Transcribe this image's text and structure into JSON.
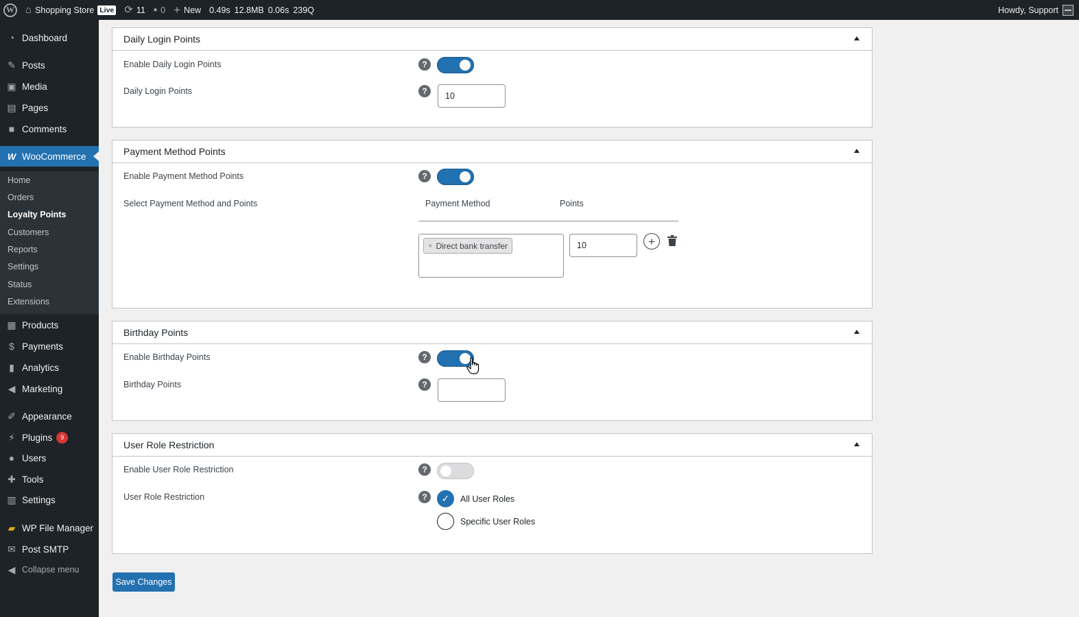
{
  "adminbar": {
    "site_name": "Shopping Store",
    "live_badge": "Live",
    "updates_count": "11",
    "comments_count": "0",
    "new_label": "New",
    "perf": [
      "0.49s",
      "12.8MB",
      "0.06s",
      "239Q"
    ],
    "greeting": "Howdy, Support"
  },
  "sidebar": {
    "items": [
      {
        "label": "Dashboard",
        "icon": "dashboard-icon"
      },
      {
        "label": "Posts",
        "icon": "pushpin-icon"
      },
      {
        "label": "Media",
        "icon": "media-icon"
      },
      {
        "label": "Pages",
        "icon": "pages-icon"
      },
      {
        "label": "Comments",
        "icon": "comment-icon"
      },
      {
        "label": "WooCommerce",
        "icon": "woocommerce-icon"
      },
      {
        "label": "Products",
        "icon": "products-icon"
      },
      {
        "label": "Payments",
        "icon": "payments-icon"
      },
      {
        "label": "Analytics",
        "icon": "analytics-icon"
      },
      {
        "label": "Marketing",
        "icon": "megaphone-icon"
      },
      {
        "label": "Appearance",
        "icon": "brush-icon"
      },
      {
        "label": "Plugins",
        "icon": "plugin-icon",
        "badge": "9"
      },
      {
        "label": "Users",
        "icon": "users-icon"
      },
      {
        "label": "Tools",
        "icon": "wrench-icon"
      },
      {
        "label": "Settings",
        "icon": "settings-icon"
      },
      {
        "label": "WP File Manager",
        "icon": "folder-icon"
      },
      {
        "label": "Post SMTP",
        "icon": "mail-icon"
      },
      {
        "label": "Collapse menu",
        "icon": "collapse-icon"
      }
    ],
    "submenu": [
      "Home",
      "Orders",
      "Loyalty Points",
      "Customers",
      "Reports",
      "Settings",
      "Status",
      "Extensions"
    ]
  },
  "panels": {
    "daily": {
      "title": "Daily Login Points",
      "enable_label": "Enable Daily Login Points",
      "enabled": true,
      "points_label": "Daily Login Points",
      "points_value": "10"
    },
    "payment": {
      "title": "Payment Method Points",
      "enable_label": "Enable Payment Method Points",
      "enabled": true,
      "select_label": "Select Payment Method and Points",
      "col_method": "Payment Method",
      "col_points": "Points",
      "selected_method": "Direct bank transfer",
      "chip_remove": "×",
      "points_value": "10"
    },
    "birthday": {
      "title": "Birthday Points",
      "enable_label": "Enable Birthday Points",
      "enabled": true,
      "points_label": "Birthday Points",
      "points_value": ""
    },
    "role": {
      "title": "User Role Restriction",
      "enable_label": "Enable User Role Restriction",
      "enabled": false,
      "restriction_label": "User Role Restriction",
      "options": [
        "All User Roles",
        "Specific User Roles"
      ],
      "selected": "All User Roles"
    }
  },
  "help_glyph": "?",
  "save_label": "Save Changes",
  "colors": {
    "accent": "#2271b1",
    "adminbar": "#1d2327",
    "sidebar": "#1d2327",
    "submenu": "#2c3338",
    "badge": "#d63638"
  }
}
